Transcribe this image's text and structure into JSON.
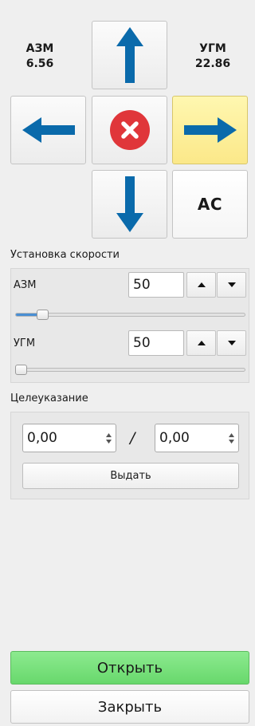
{
  "colors": {
    "arrow_blue": "#0a6aab",
    "stop_red": "#e0363a",
    "active_yellow": "#fbe889",
    "open_green": "#76e27a"
  },
  "readouts": {
    "azm_label": "АЗМ",
    "azm_value": "6.56",
    "ugm_label": "УГМ",
    "ugm_value": "22.86"
  },
  "pad": {
    "up_icon": "arrow-up-icon",
    "left_icon": "arrow-left-icon",
    "stop_icon": "stop-icon",
    "right_icon": "arrow-right-icon",
    "down_icon": "arrow-down-icon",
    "ac_label": "АС",
    "active_button": "right"
  },
  "speed": {
    "title": "Установка скорости",
    "azm": {
      "label": "АЗМ",
      "value": "50",
      "slider_fraction": 0.1
    },
    "ugm": {
      "label": "УГМ",
      "value": "50",
      "slider_fraction": 0.0
    }
  },
  "target": {
    "title": "Целеуказание",
    "value1": "0,00",
    "separator": "/",
    "value2": "0,00",
    "submit_label": "Выдать"
  },
  "footer": {
    "open_label": "Открыть",
    "close_label": "Закрыть"
  }
}
